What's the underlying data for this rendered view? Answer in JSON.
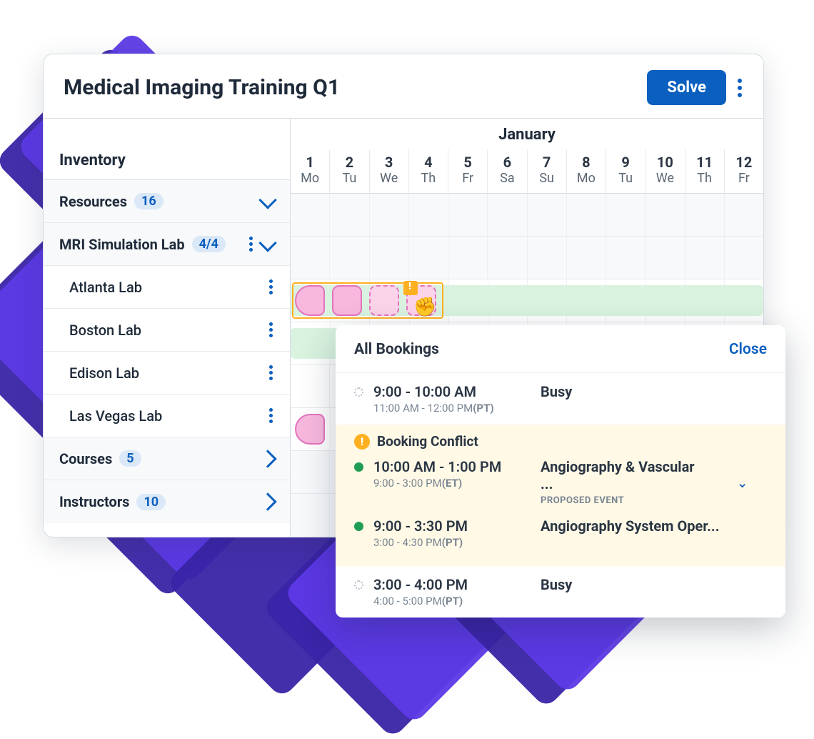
{
  "header": {
    "title": "Medical Imaging Training Q1",
    "solve_label": "Solve"
  },
  "inventory_label": "Inventory",
  "month": "January",
  "days": [
    {
      "num": "1",
      "abbr": "Mo"
    },
    {
      "num": "2",
      "abbr": "Tu"
    },
    {
      "num": "3",
      "abbr": "We"
    },
    {
      "num": "4",
      "abbr": "Th"
    },
    {
      "num": "5",
      "abbr": "Fr"
    },
    {
      "num": "6",
      "abbr": "Sa"
    },
    {
      "num": "7",
      "abbr": "Su"
    },
    {
      "num": "8",
      "abbr": "Mo"
    },
    {
      "num": "9",
      "abbr": "Tu"
    },
    {
      "num": "10",
      "abbr": "We"
    },
    {
      "num": "11",
      "abbr": "Th"
    },
    {
      "num": "12",
      "abbr": "Fr"
    }
  ],
  "rows": {
    "resources": {
      "label": "Resources",
      "count": "16"
    },
    "mri": {
      "label": "MRI Simulation Lab",
      "count": "4/4"
    },
    "atlanta": {
      "label": "Atlanta Lab"
    },
    "boston": {
      "label": "Boston Lab"
    },
    "edison": {
      "label": "Edison Lab"
    },
    "vegas": {
      "label": "Las Vegas Lab"
    },
    "courses": {
      "label": "Courses",
      "count": "5"
    },
    "instructors": {
      "label": "Instructors",
      "count": "10"
    }
  },
  "popover": {
    "title": "All Bookings",
    "close": "Close",
    "busy1": {
      "time": "9:00 - 10:00 AM",
      "sub": "11:00 AM - 12:00 PM",
      "tz": "(PT)",
      "label": "Busy"
    },
    "conflict_label": "Booking Conflict",
    "c1": {
      "time": "10:00 AM - 1:00 PM",
      "sub": "9:00 - 3:00 PM",
      "tz": "(ET)",
      "label": "Angiography & Vascular ...",
      "meta": "PROPOSED EVENT"
    },
    "c2": {
      "time": "9:00 - 3:30 PM",
      "sub": "3:00 - 4:30 PM",
      "tz": "(PT)",
      "label": "Angiography System Oper..."
    },
    "busy2": {
      "time": "3:00 - 4:00 PM",
      "sub": "4:00 - 5:00 PM",
      "tz": "(PT)",
      "label": "Busy"
    }
  }
}
